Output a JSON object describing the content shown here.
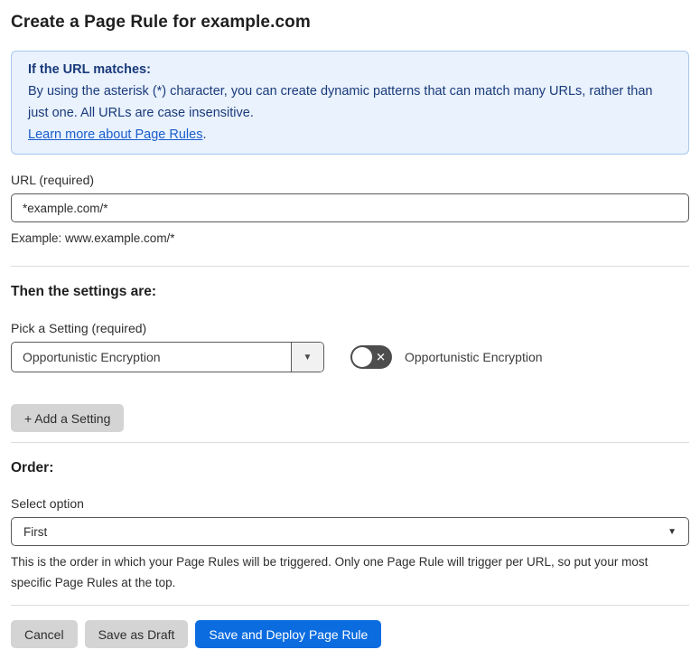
{
  "page": {
    "title": "Create a Page Rule for example.com"
  },
  "info_box": {
    "heading": "If the URL matches:",
    "body": "By using the asterisk (*) character, you can create dynamic patterns that can match many URLs, rather than just one. All URLs are case insensitive.",
    "link_label": "Learn more about Page Rules",
    "link_suffix": "."
  },
  "url_field": {
    "label": "URL (required)",
    "value": "*example.com/*",
    "example": "Example: www.example.com/*"
  },
  "settings": {
    "heading": "Then the settings are:",
    "pick_label": "Pick a Setting (required)",
    "selected_setting": "Opportunistic Encryption",
    "toggle_label": "Opportunistic Encryption",
    "toggle_state": "off",
    "add_button_label": "+ Add a Setting"
  },
  "order": {
    "heading": "Order:",
    "select_label": "Select option",
    "selected_option": "First",
    "help_text": "This is the order in which your Page Rules will be triggered. Only one Page Rule will trigger per URL, so put your most specific Page Rules at the top."
  },
  "footer": {
    "cancel_label": "Cancel",
    "save_draft_label": "Save as Draft",
    "save_deploy_label": "Save and Deploy Page Rule"
  },
  "icons": {
    "dropdown_caret": "▼",
    "select_caret": "▼",
    "toggle_x": "✕"
  },
  "colors": {
    "primary_blue": "#0b6ce0",
    "button_gray": "#d4d4d4",
    "info_bg": "#e9f2fd",
    "info_border": "#a9c8ef",
    "info_text": "#1a3a7a",
    "link_blue": "#1b5ecc",
    "toggle_off": "#4d4d4d"
  }
}
